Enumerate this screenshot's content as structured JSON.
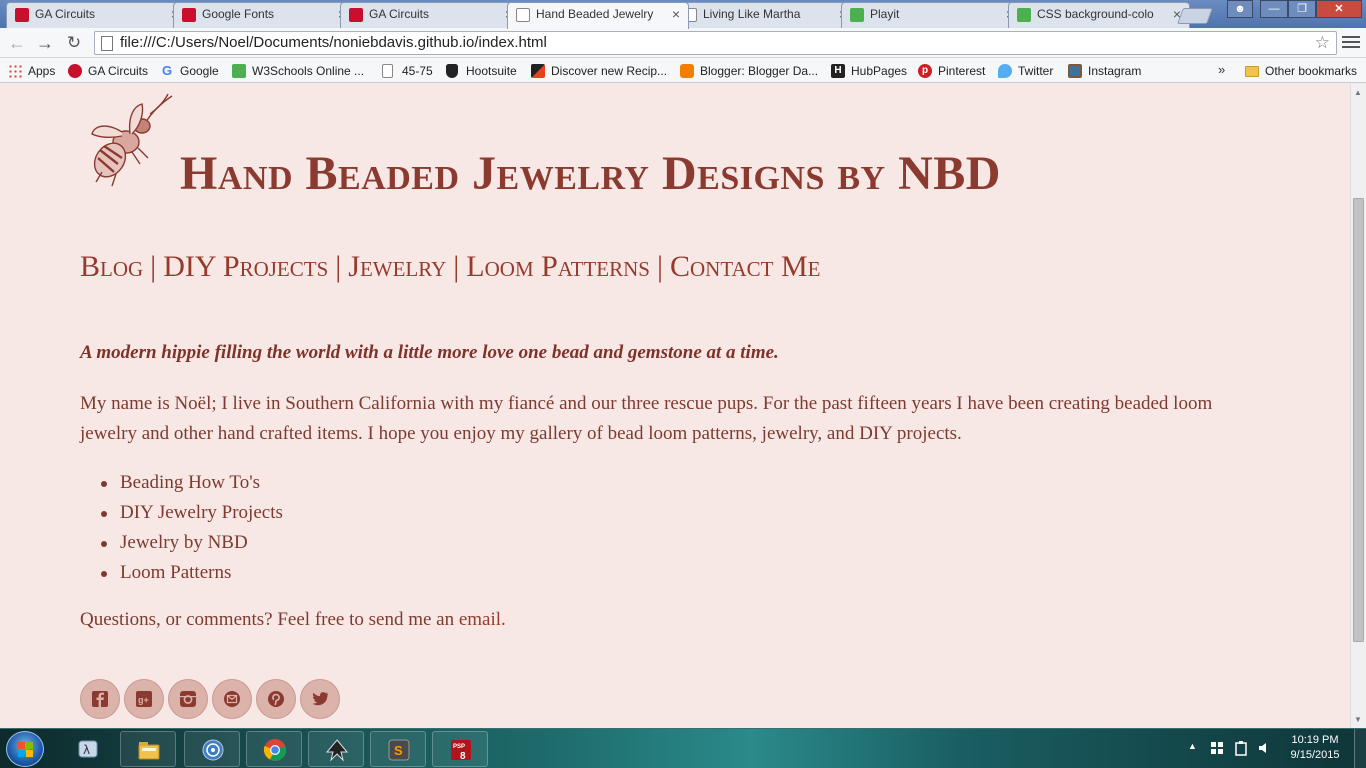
{
  "browser": {
    "tabs": [
      {
        "label": "GA Circuits",
        "icon": "ga-circuits-icon",
        "color": "#c8102e",
        "active": false
      },
      {
        "label": "Google Fonts",
        "icon": "google-fonts-icon",
        "color": "#c8102e",
        "active": false
      },
      {
        "label": "GA Circuits",
        "icon": "ga-circuits-icon",
        "color": "#c8102e",
        "active": false
      },
      {
        "label": "Hand Beaded Jewelry",
        "icon": "page-icon",
        "color": "#ffffff",
        "active": true
      },
      {
        "label": "Living Like Martha",
        "icon": "page-icon",
        "color": "#ffffff",
        "active": false
      },
      {
        "label": "Playit",
        "icon": "w3schools-icon",
        "color": "#4caf50",
        "active": false
      },
      {
        "label": "CSS background-colo",
        "icon": "w3schools-icon",
        "color": "#4caf50",
        "active": false
      }
    ],
    "tab_close_glyph": "×",
    "url": "file:///C:/Users/Noel/Documents/noniebdavis.github.io/index.html",
    "bookmarks": [
      {
        "label": "Apps",
        "icon": "apps-grid-icon",
        "color": "#d44638"
      },
      {
        "label": "GA Circuits",
        "icon": "ga-circuits-icon",
        "color": "#c8102e"
      },
      {
        "label": "Google",
        "icon": "google-icon",
        "color": "#4285f4"
      },
      {
        "label": "W3Schools Online ...",
        "icon": "w3schools-icon",
        "color": "#4caf50"
      },
      {
        "label": "45-75",
        "icon": "page-icon",
        "color": "#ffffff"
      },
      {
        "label": "Hootsuite",
        "icon": "hootsuite-icon",
        "color": "#222222"
      },
      {
        "label": "Discover new Recip...",
        "icon": "recipe-icon",
        "color": "#e8411f"
      },
      {
        "label": "Blogger: Blogger Da...",
        "icon": "blogger-icon",
        "color": "#f57d00"
      },
      {
        "label": "HubPages",
        "icon": "hubpages-icon",
        "color": "#222222"
      },
      {
        "label": "Pinterest",
        "icon": "pinterest-icon",
        "color": "#cb2027"
      },
      {
        "label": "Twitter",
        "icon": "twitter-icon",
        "color": "#55acee"
      },
      {
        "label": "Instagram",
        "icon": "instagram-icon",
        "color": "#3f729b"
      }
    ],
    "bookmarks_overflow": "»",
    "other_bookmarks": "Other bookmarks"
  },
  "page": {
    "site_title": "Hand Beaded Jewelry Designs by NBD",
    "nav": [
      {
        "label": "Blog"
      },
      {
        "label": "DIY Projects"
      },
      {
        "label": "Jewelry"
      },
      {
        "label": "Loom Patterns"
      },
      {
        "label": "Contact Me"
      }
    ],
    "nav_separator": "|",
    "tagline": "A modern hippie filling the world with a little more love one bead and gemstone at a time.",
    "intro": "My name is Noël; I live in Southern California with my fiancé and our three rescue pups. For the past fifteen years I have been creating beaded loom jewelry and other hand crafted items. I hope you enjoy my gallery of bead loom patterns, jewelry, and DIY projects.",
    "links": [
      {
        "label": "Beading How To's"
      },
      {
        "label": "DIY Jewelry Projects"
      },
      {
        "label": "Jewelry by NBD"
      },
      {
        "label": "Loom Patterns"
      }
    ],
    "contact_prefix": "Questions, or comments? Feel free to send me an ",
    "contact_link": "email",
    "contact_suffix": ".",
    "social": [
      "facebook-icon",
      "google-plus-icon",
      "instagram-icon",
      "email-icon",
      "pinterest-icon",
      "twitter-icon"
    ],
    "colors": {
      "title": "#8b3a2f",
      "background": "#f7e8e6",
      "social_bg": "#dcb3ab"
    }
  },
  "taskbar": {
    "clock_time": "10:19 PM",
    "clock_date": "9/15/2015",
    "apps": [
      "lambda-app-icon",
      "file-explorer-icon",
      "network-app-icon",
      "chrome-icon",
      "inkscape-icon",
      "sublime-text-icon",
      "paint-shop-pro-icon"
    ]
  }
}
